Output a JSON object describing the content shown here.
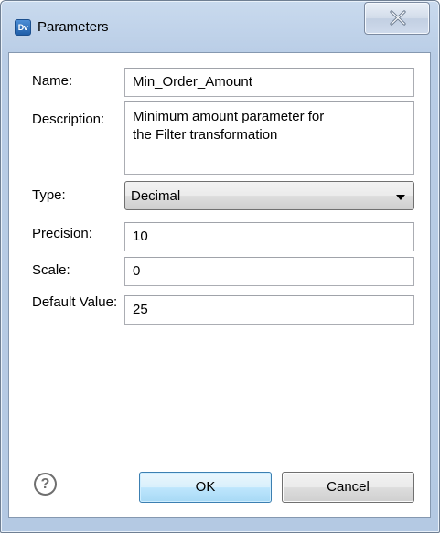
{
  "window": {
    "title": "Parameters",
    "app_icon_text": "Dv",
    "app_icon": "dv-app-icon",
    "close_icon": "close-x-icon"
  },
  "form": {
    "name_label": "Name:",
    "name_value": "Min_Order_Amount",
    "description_label": "Description:",
    "description_value": "Minimum amount parameter for\nthe Filter transformation",
    "type_label": "Type:",
    "type_value": "Decimal",
    "precision_label": "Precision:",
    "precision_value": "10",
    "scale_label": "Scale:",
    "scale_value": "0",
    "default_value_label": "Default Value:",
    "default_value_value": "25"
  },
  "footer": {
    "help_glyph": "?",
    "help_icon": "help-question-icon",
    "ok_label": "OK",
    "cancel_label": "Cancel"
  },
  "colors": {
    "frame": "#b9cde6",
    "ok_button": "#bee6fd",
    "ok_border": "#3c7fb1"
  }
}
